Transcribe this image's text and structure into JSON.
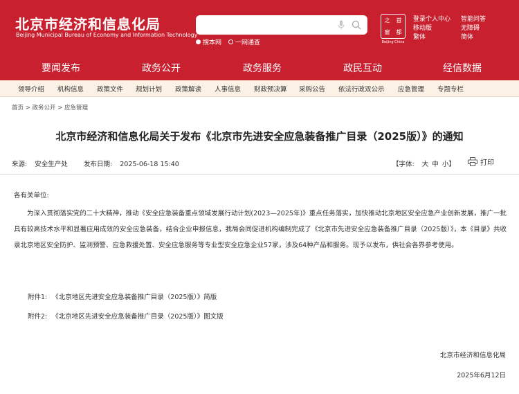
{
  "header": {
    "logo_cn": "北京市经济和信息化局",
    "logo_en": "Beijing Municipal Bureau of Economy and Information Technology",
    "search": {
      "placeholder": "",
      "value": ""
    },
    "search_scope": [
      "搜本网",
      "一网通查"
    ],
    "badge_chars": [
      "之",
      "首",
      "窗",
      "都"
    ],
    "badge_sub": "Beijing·China",
    "tools": {
      "login": "登录个人中心",
      "mobile": "移动版",
      "traditional": "繁体",
      "smart_qa": "智能问答",
      "accessibility": "无障碍",
      "simplified": "简体"
    }
  },
  "main_nav": [
    "要闻发布",
    "政务公开",
    "政务服务",
    "政民互动",
    "经信数据"
  ],
  "sub_nav": [
    "领导介绍",
    "机构信息",
    "政策文件",
    "规划计划",
    "政策解读",
    "人事信息",
    "财政预决算",
    "采购公告",
    "依法行政双公示",
    "应急管理",
    "专题专栏"
  ],
  "breadcrumb": "首页 > 政务公开 > 应急管理",
  "article": {
    "title": "北京市经济和信息化局关于发布《北京市先进安全应急装备推广目录（2025版）》的通知",
    "source_label": "来源:",
    "source": "安全生产处",
    "date_label": "发布日期:",
    "date": "2025-06-18 15:40",
    "font_label": "【字体:",
    "font_large": "大",
    "font_medium": "中",
    "font_small": "小】",
    "print_label": "打印",
    "greeting": "各有关单位:",
    "body": "为深入贯彻落实党的二十大精神，推动《安全应急装备重点领域发展行动计划(2023—2025年)》重点任务落实，加快推动北京地区安全应急产业创新发展，推广一批具有较高技术水平和显著应用成效的安全应急装备，结合企业申报信息，我局会同促进机构编制完成了《北京市先进安全应急装备推广目录（2025版）》，本《目录》共收录北京地区安全防护、监测预警、应急救援处置、安全应急服务等专业型安全应急企业57家，涉及64种产品和服务。现予以发布，供社会各界参考使用。",
    "attachments": [
      {
        "label": "附件1:",
        "name": "《北京地区先进安全应急装备推广目录（2025版）》简版"
      },
      {
        "label": "附件2:",
        "name": "《北京地区先进安全应急装备推广目录（2025版）》图文版"
      }
    ],
    "signature": "北京市经济和信息化局",
    "sign_date": "2025年6月12日"
  },
  "colors": {
    "primary": "#c8202f",
    "subnav_bg": "#fbf1e5"
  },
  "icons": [
    "mic-icon",
    "search-icon",
    "printer-icon"
  ]
}
